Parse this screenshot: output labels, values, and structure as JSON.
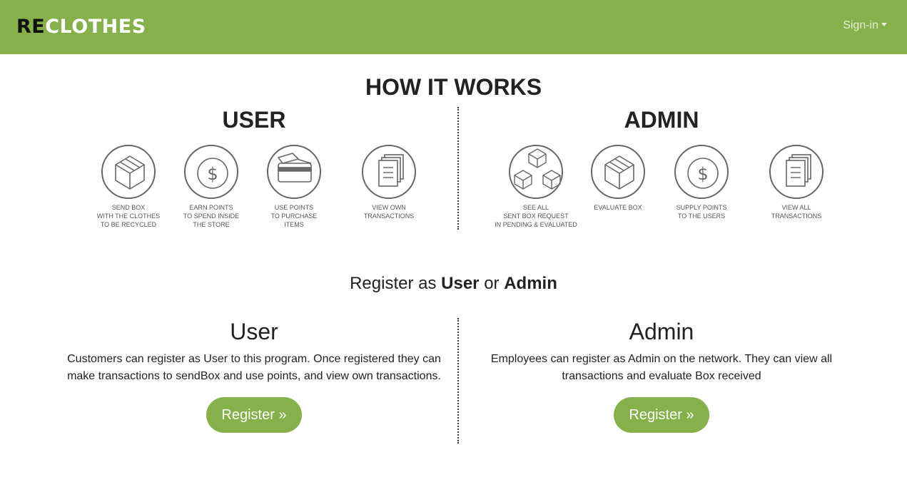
{
  "navbar": {
    "brand_re": "RE",
    "brand_rest": "CLOTHES",
    "signin_label": "Sign-in"
  },
  "how_it_works": {
    "title": "HOW IT WORKS",
    "user_title": "USER",
    "admin_title": "ADMIN",
    "user_steps": [
      {
        "icon": "box-icon",
        "caption": "SEND BOX\nWITH THE CLOTHES\nTO BE RECYCLED"
      },
      {
        "icon": "dollar-icon",
        "caption": "EARN POINTS\nTO SPEND INSIDE\nTHE STORE"
      },
      {
        "icon": "card-icon",
        "caption": "USE POINTS\nTO PURCHASE\nITEMS"
      },
      {
        "icon": "documents-icon",
        "caption": "VIEW OWN\nTRANSACTIONS"
      }
    ],
    "admin_steps": [
      {
        "icon": "boxes-icon",
        "caption": "SEE ALL\nSENT BOX REQUEST\nIN PENDING & EVALUATED"
      },
      {
        "icon": "box-icon",
        "caption": "EVALUATE BOX"
      },
      {
        "icon": "dollar-icon",
        "caption": "SUPPLY POINTS\nTO THE USERS"
      },
      {
        "icon": "documents-icon",
        "caption": "VIEW ALL\nTRANSACTIONS"
      }
    ]
  },
  "register": {
    "heading_prefix": "Register as ",
    "heading_user": "User",
    "heading_or": " or ",
    "heading_admin": "Admin",
    "user_panel": {
      "title": "User",
      "text": "Customers can register as User to this program. Once registered they can make transactions to sendBox and use points, and view own transactions.",
      "button": "Register »"
    },
    "admin_panel": {
      "title": "Admin",
      "text": "Employees can register as Admin on the network. They can view all transactions and evaluate Box received",
      "button": "Register »"
    }
  },
  "colors": {
    "accent": "#86b04a",
    "icon_stroke": "#666666"
  }
}
